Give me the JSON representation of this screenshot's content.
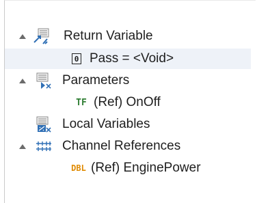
{
  "tree": {
    "return_variable": {
      "label": "Return Variable",
      "icon": "return-variable-icon",
      "expanded": true,
      "children": [
        {
          "label": "Pass = <Void>",
          "badge": "0",
          "icon": "void-type-icon"
        }
      ]
    },
    "parameters": {
      "label": "Parameters",
      "icon": "parameters-icon",
      "expanded": true,
      "children": [
        {
          "label": "(Ref) OnOff",
          "badge": "TF",
          "icon": "boolean-type-icon"
        }
      ]
    },
    "local_variables": {
      "label": "Local Variables",
      "icon": "local-variables-icon",
      "expanded": false
    },
    "channel_references": {
      "label": "Channel References",
      "icon": "channel-references-icon",
      "expanded": true,
      "children": [
        {
          "label": "(Ref) EnginePower",
          "badge": "DBL",
          "icon": "double-type-icon"
        }
      ]
    }
  },
  "colors": {
    "selection": "#eef2f8",
    "boolean_badge": "#2e7d32",
    "double_badge": "#e08a00",
    "icon_blue": "#2f6fb5"
  }
}
